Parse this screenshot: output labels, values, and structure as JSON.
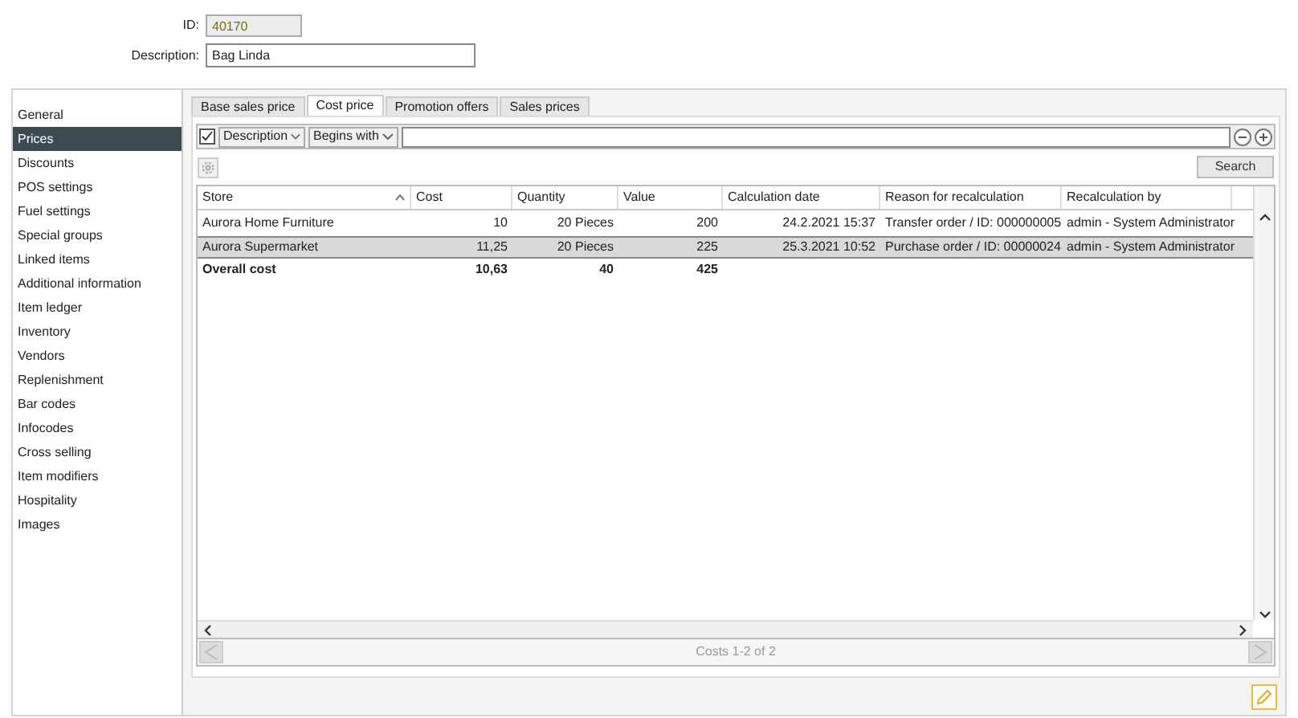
{
  "header": {
    "id_label": "ID:",
    "id_value": "40170",
    "description_label": "Description:",
    "description_value": "Bag Linda"
  },
  "sidebar": {
    "items": [
      {
        "label": "General",
        "selected": false
      },
      {
        "label": "Prices",
        "selected": true
      },
      {
        "label": "Discounts",
        "selected": false
      },
      {
        "label": "POS settings",
        "selected": false
      },
      {
        "label": "Fuel settings",
        "selected": false
      },
      {
        "label": "Special groups",
        "selected": false
      },
      {
        "label": "Linked items",
        "selected": false
      },
      {
        "label": "Additional information",
        "selected": false
      },
      {
        "label": "Item ledger",
        "selected": false
      },
      {
        "label": "Inventory",
        "selected": false
      },
      {
        "label": "Vendors",
        "selected": false
      },
      {
        "label": "Replenishment",
        "selected": false
      },
      {
        "label": "Bar codes",
        "selected": false
      },
      {
        "label": "Infocodes",
        "selected": false
      },
      {
        "label": "Cross selling",
        "selected": false
      },
      {
        "label": "Item modifiers",
        "selected": false
      },
      {
        "label": "Hospitality",
        "selected": false
      },
      {
        "label": "Images",
        "selected": false
      }
    ]
  },
  "tabs": [
    {
      "label": "Base sales price",
      "selected": false
    },
    {
      "label": "Cost price",
      "selected": true
    },
    {
      "label": "Promotion offers",
      "selected": false
    },
    {
      "label": "Sales prices",
      "selected": false
    }
  ],
  "filter": {
    "checked": true,
    "field": "Description",
    "operator": "Begins with"
  },
  "search_button": "Search",
  "table": {
    "columns": [
      {
        "label": "Store",
        "sorted": true
      },
      {
        "label": "Cost",
        "sorted": false
      },
      {
        "label": "Quantity",
        "sorted": false
      },
      {
        "label": "Value",
        "sorted": false
      },
      {
        "label": "Calculation date",
        "sorted": false
      },
      {
        "label": "Reason for recalculation",
        "sorted": false
      },
      {
        "label": "Recalculation by",
        "sorted": false
      }
    ],
    "rows": [
      {
        "cells": [
          "Aurora Home Furniture",
          "10",
          "20 Pieces",
          "200",
          "24.2.2021 15:37",
          "Transfer order / ID: 000000005",
          "admin - System Administrator"
        ],
        "selected": false
      },
      {
        "cells": [
          "Aurora Supermarket",
          "11,25",
          "20 Pieces",
          "225",
          "25.3.2021 10:52",
          "Purchase order / ID: 00000024",
          "admin - System Administrator"
        ],
        "selected": true
      }
    ],
    "total": [
      "Overall cost",
      "10,63",
      "40",
      "425"
    ]
  },
  "pager": "Costs 1-2 of 2"
}
